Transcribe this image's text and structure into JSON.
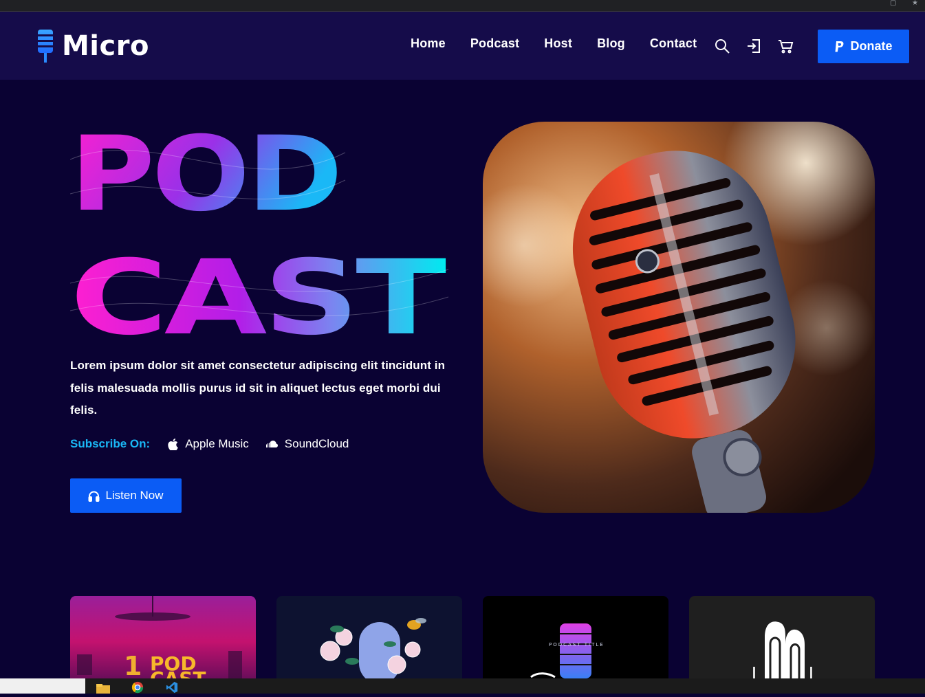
{
  "brand": {
    "name": "Micro"
  },
  "nav": {
    "items": [
      {
        "label": "Home"
      },
      {
        "label": "Podcast"
      },
      {
        "label": "Host"
      },
      {
        "label": "Blog"
      },
      {
        "label": "Contact"
      }
    ],
    "icons": [
      "search-icon",
      "login-icon",
      "cart-icon"
    ],
    "donate_label": "Donate"
  },
  "hero": {
    "title_line1": "POD",
    "title_line2": "CAST",
    "description": "Lorem ipsum dolor sit amet consectetur adipiscing elit tincidunt in felis malesuada mollis purus id sit in aliquet lectus eget morbi dui felis.",
    "subscribe_label": "Subscribe On:",
    "services": [
      {
        "label": "Apple Music",
        "icon": "apple-icon"
      },
      {
        "label": "SoundCloud",
        "icon": "soundcloud-icon"
      }
    ],
    "listen_label": "Listen Now"
  },
  "cards": [
    {
      "label": "POD",
      "label2": "CAST",
      "badge": "1"
    },
    {
      "label": ""
    },
    {
      "label": "PODCAST TITLE"
    },
    {
      "label": ""
    }
  ],
  "colors": {
    "background": "#0a0233",
    "header": "#150c4a",
    "accent": "#0b5cf5",
    "subscribe": "#1ab8f6",
    "gradient_start": "#ff1fd0",
    "gradient_mid": "#8a2be2",
    "gradient_end": "#00e5f0"
  }
}
